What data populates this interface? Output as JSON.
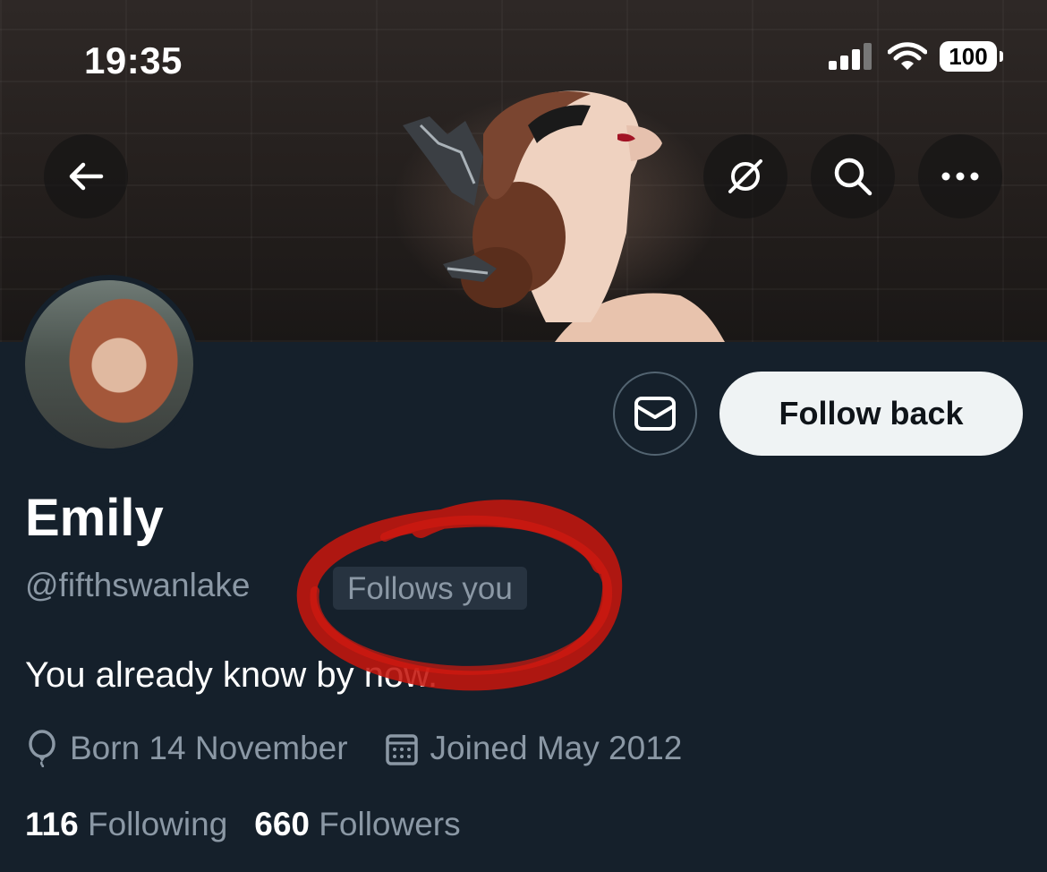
{
  "status_bar": {
    "time": "19:35",
    "battery": "100"
  },
  "profile": {
    "name": "Emily",
    "handle": "@fifthswanlake",
    "follows_badge": "Follows you",
    "bio": "You already know by now.",
    "birthday": "Born 14 November",
    "joined": "Joined May 2012",
    "following_count": "116",
    "following_label": "Following",
    "followers_count": "660",
    "followers_label": "Followers"
  },
  "actions": {
    "follow_back_label": "Follow back"
  },
  "icons": {
    "back": "arrow-left-icon",
    "grok": "slashed-circle-icon",
    "search": "search-icon",
    "more": "more-dots-icon",
    "message": "envelope-icon",
    "location": "balloon-icon",
    "calendar": "calendar-icon"
  },
  "colors": {
    "background": "#15202b",
    "secondary_text": "#8b98a5",
    "badge_bg": "#273340",
    "button_bg": "#eff3f4",
    "annotation": "#c4160e"
  }
}
